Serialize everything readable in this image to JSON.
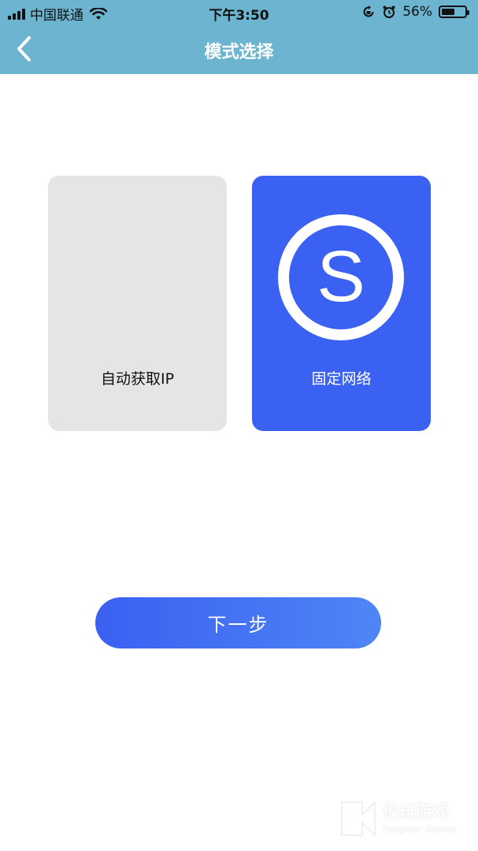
{
  "status_bar": {
    "carrier": "中国联通",
    "time": "下午3:50",
    "battery": "56%",
    "battery_level": 0.56
  },
  "nav": {
    "title": "模式选择",
    "back_icon": "chevron-left-icon"
  },
  "modes": [
    {
      "label": "自动获取IP",
      "selected": false
    },
    {
      "label": "固定网络",
      "selected": true,
      "icon": "s-circle-icon"
    }
  ],
  "next_button": {
    "label": "下一步"
  },
  "watermark": {
    "title": "仍玩游戏",
    "subtitle": "Rengwan Games"
  },
  "colors": {
    "header": "#6cb4cf",
    "selected_card": "#3a61f2",
    "unselected_card": "#e5e5e5",
    "button_start": "#3b60f1",
    "button_end": "#4e86f6"
  }
}
